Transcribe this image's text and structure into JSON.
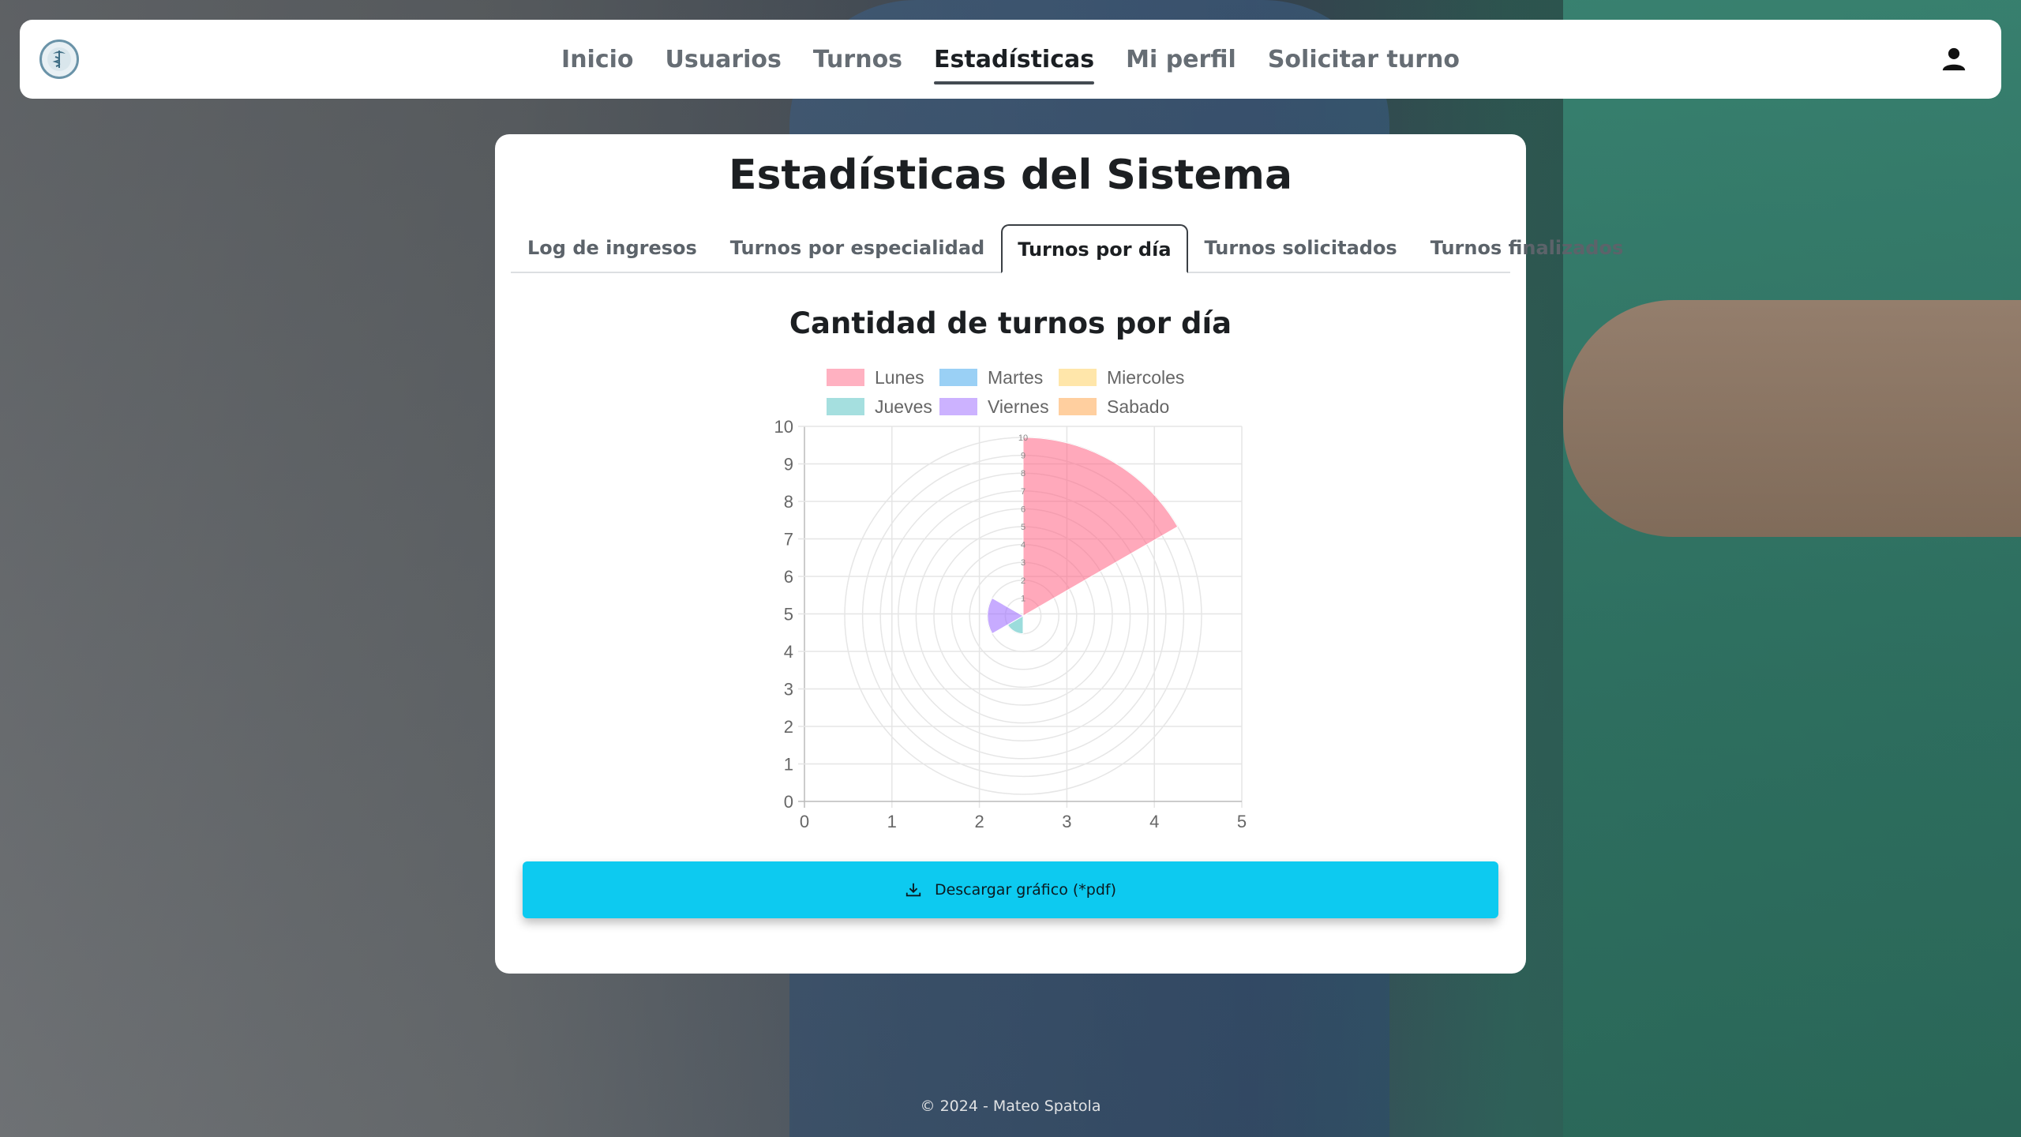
{
  "nav": {
    "logo_icon": "caduceus-logo-icon",
    "links": [
      {
        "label": "Inicio",
        "active": false
      },
      {
        "label": "Usuarios",
        "active": false
      },
      {
        "label": "Turnos",
        "active": false
      },
      {
        "label": "Estadísticas",
        "active": true
      },
      {
        "label": "Mi perfil",
        "active": false
      },
      {
        "label": "Solicitar turno",
        "active": false
      }
    ],
    "user_icon": "person-icon"
  },
  "card": {
    "title": "Estadísticas del Sistema",
    "tabs": [
      {
        "label": "Log de ingresos",
        "active": false
      },
      {
        "label": "Turnos por especialidad",
        "active": false
      },
      {
        "label": "Turnos por día",
        "active": true
      },
      {
        "label": "Turnos solicitados",
        "active": false
      },
      {
        "label": "Turnos finalizados",
        "active": false
      }
    ],
    "download_label": "Descargar gráfico (*pdf)",
    "download_icon": "download-icon"
  },
  "chart_data": {
    "type": "polarArea",
    "title": "Cantidad de turnos por día",
    "categories": [
      "Lunes",
      "Martes",
      "Miercoles",
      "Jueves",
      "Viernes",
      "Sabado"
    ],
    "values": [
      10,
      0,
      0,
      1,
      2,
      0
    ],
    "colors": [
      "#ff6384",
      "#36a2eb",
      "#ffcd56",
      "#4bc0c0",
      "#9966ff",
      "#ff9f40"
    ],
    "legend_position": "top",
    "radial_range": [
      0,
      10
    ],
    "radial_ticks": [
      "0",
      "1",
      "2",
      "3",
      "4",
      "5",
      "6",
      "7",
      "8",
      "9",
      "10"
    ],
    "cartesian_x_ticks": [
      "0",
      "1",
      "2",
      "3",
      "4",
      "5"
    ],
    "cartesian_y_ticks": [
      "0",
      "1",
      "2",
      "3",
      "4",
      "5",
      "6",
      "7",
      "8",
      "9",
      "10"
    ],
    "grid": true
  },
  "footer": "© 2024 - Mateo Spatola"
}
